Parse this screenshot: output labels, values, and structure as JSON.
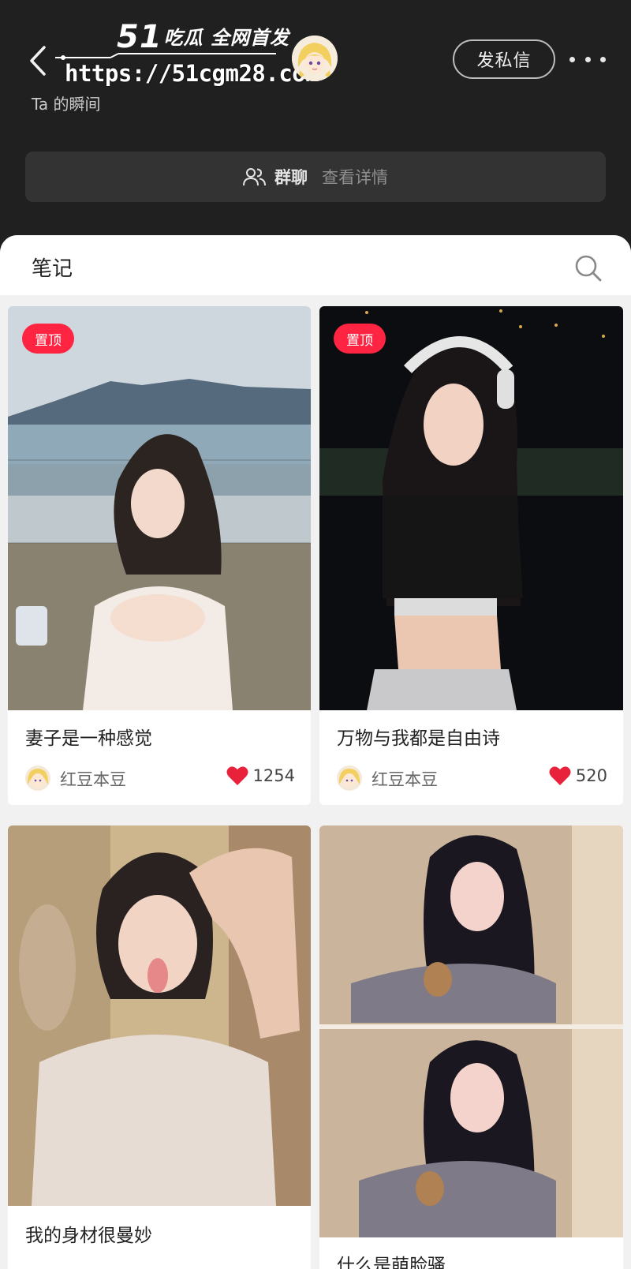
{
  "watermark": {
    "number": "51",
    "tagline": "吃瓜 全网首发",
    "url": "https://51cgm28.com"
  },
  "header": {
    "dm_label": "发私信",
    "moments_text": "Ta 的瞬间",
    "group_label": "群聊",
    "group_detail": "查看详情"
  },
  "notes": {
    "title": "笔记",
    "pin_label": "置顶",
    "cards": [
      {
        "title": "妻子是一种感觉",
        "author": "红豆本豆",
        "likes": "1254",
        "pinned": true
      },
      {
        "title": "万物与我都是自由诗",
        "author": "红豆本豆",
        "likes": "520",
        "pinned": true
      },
      {
        "title": "我的身材很曼妙",
        "author": "",
        "likes": "",
        "pinned": false
      },
      {
        "title": "什么是萌脸骚",
        "author": "",
        "likes": "",
        "pinned": false
      }
    ]
  },
  "icons": {
    "back": "chevron-left-icon",
    "more": "more-dots-icon",
    "group": "people-icon",
    "search": "search-icon",
    "like": "heart-icon"
  },
  "colors": {
    "header_bg": "#202020",
    "accent_red": "#ff2442",
    "like_red": "#e8223a",
    "panel_bg": "#f1f1f1"
  }
}
